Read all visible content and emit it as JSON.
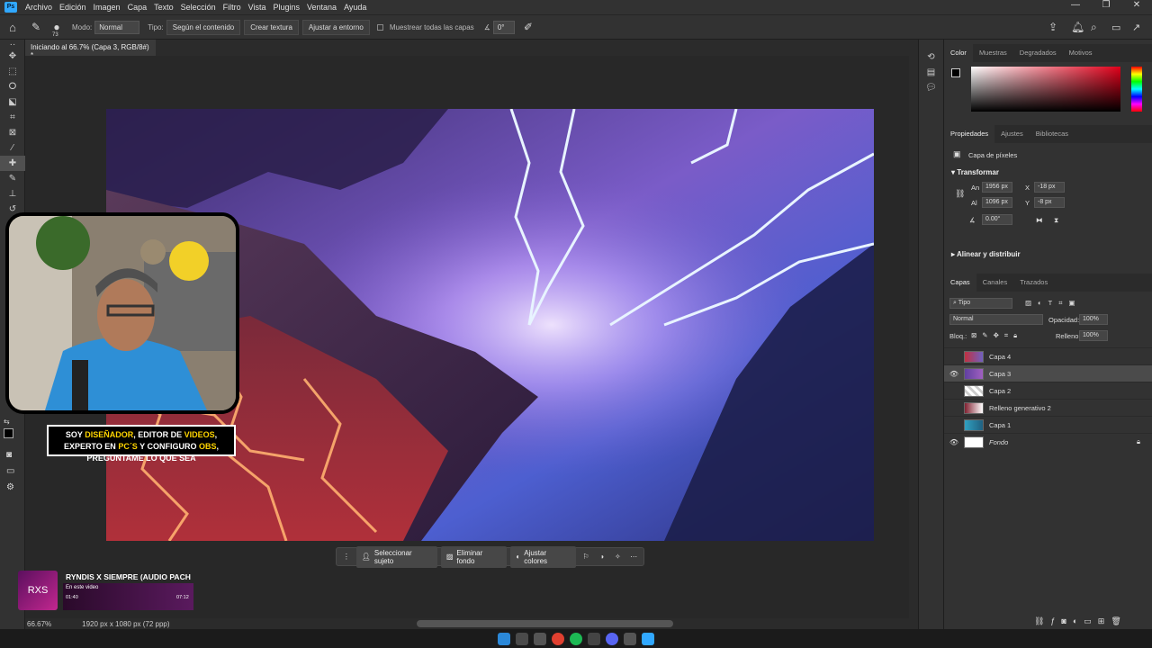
{
  "menu": {
    "logo": "Ps",
    "items": [
      "Archivo",
      "Edición",
      "Imagen",
      "Capa",
      "Texto",
      "Selección",
      "Filtro",
      "Vista",
      "Plugins",
      "Ventana",
      "Ayuda"
    ]
  },
  "options": {
    "mode_label": "Modo:",
    "mode_value": "Normal",
    "type_label": "Tipo:",
    "type_btn1": "Según el contenido",
    "type_btn2": "Crear textura",
    "type_btn3": "Ajustar a entorno",
    "sample_all": "Muestrear todas las capas",
    "angle": "0°",
    "brush_size": "73"
  },
  "document": {
    "tab_title": "Iniciando al 66.7% (Capa 3, RGB/8#) *",
    "zoom": "66.67%",
    "dims": "1920 px x 1080 px (72 ppp)"
  },
  "context_bar": {
    "btn1": "Seleccionar sujeto",
    "btn2": "Eliminar fondo",
    "btn3": "Ajustar colores"
  },
  "color_panel": {
    "tabs": [
      "Color",
      "Muestras",
      "Degradados",
      "Motivos"
    ],
    "accent": "#e0001a"
  },
  "properties": {
    "tabs": [
      "Propiedades",
      "Ajustes",
      "Bibliotecas"
    ],
    "layer_type": "Capa de píxeles",
    "transform_title": "Transformar",
    "w_label": "An",
    "w": "1956 px",
    "h_label": "Al",
    "h": "1096 px",
    "x_label": "X",
    "x": "-18 px",
    "y_label": "Y",
    "y": "-8 px",
    "angle": "0.00°",
    "align_title": "Alinear y distribuir"
  },
  "layers_panel": {
    "tabs": [
      "Capas",
      "Canales",
      "Trazados"
    ],
    "filter": "Tipo",
    "blend": "Normal",
    "opacity_label": "Opacidad:",
    "opacity": "100%",
    "lock_label": "Bloq.:",
    "fill_label": "Relleno:",
    "fill": "100%",
    "layers": [
      {
        "name": "Capa 4",
        "visible": false,
        "selected": false
      },
      {
        "name": "Capa 3",
        "visible": true,
        "selected": true
      },
      {
        "name": "Capa 2",
        "visible": false,
        "selected": false
      },
      {
        "name": "Relleno generativo 2",
        "visible": false,
        "selected": false
      },
      {
        "name": "Capa 1",
        "visible": false,
        "selected": false
      },
      {
        "name": "Fondo",
        "visible": true,
        "selected": false
      }
    ]
  },
  "overlay": {
    "caption_parts": [
      "SOY ",
      "DISEÑADOR",
      ", EDITOR DE ",
      "VIDEOS",
      ", EXPERTO EN ",
      "PC´S",
      " Y CONFIGURO ",
      "OBS",
      ", PREGUNTAME LO QUE SEA"
    ],
    "music_title": "RYNDIS X SIEMPRE (AUDIO PACH",
    "music_sub": "En este video",
    "music_time_start": "01:40",
    "music_time_end": "07:12",
    "music_art": "RXS"
  }
}
